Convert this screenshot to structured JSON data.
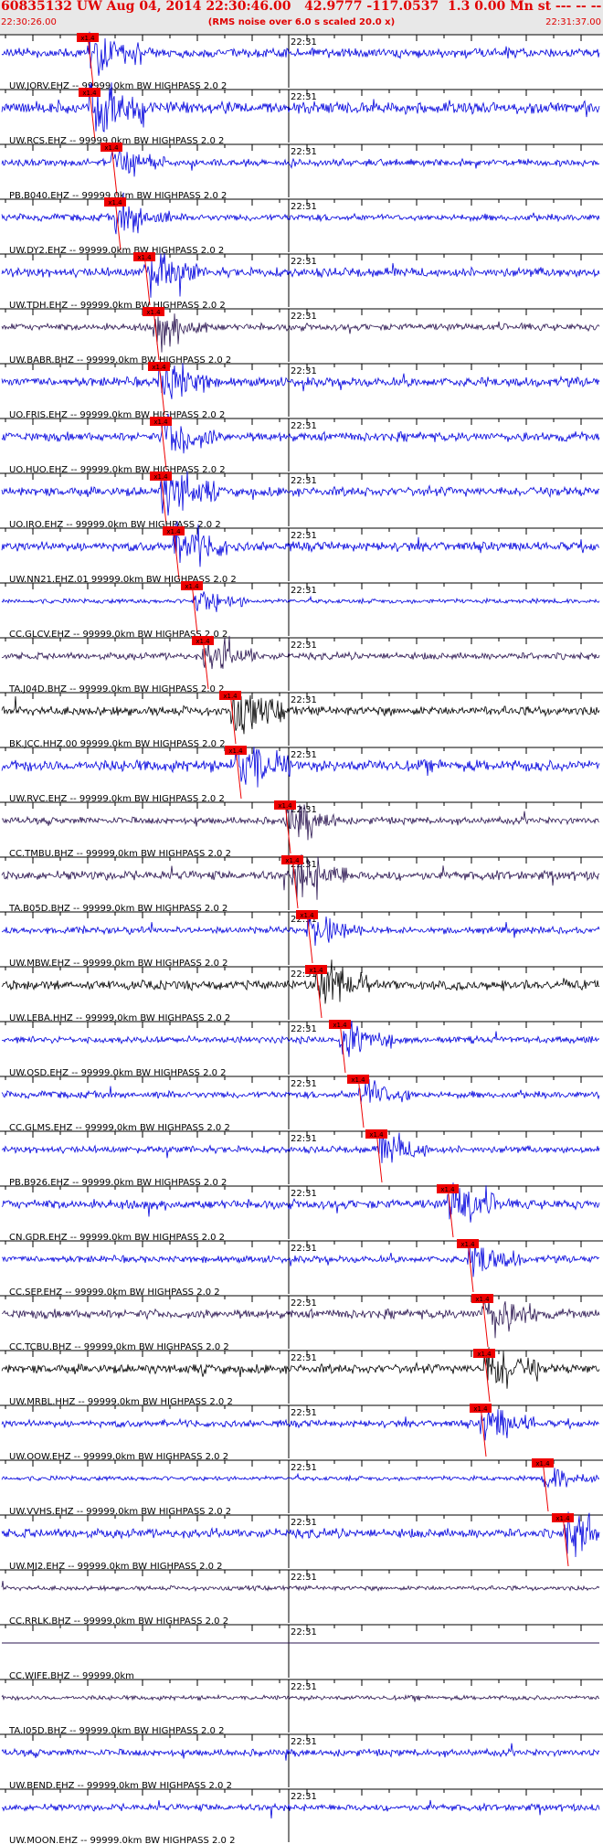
{
  "header": {
    "title": "60835132 UW Aug 04, 2014 22:30:46.00   42.9777 -117.0537  1.3 0.00 Mn st --- -- --  -1",
    "start_time": "22:30:26.00",
    "subtitle": "(RMS noise over 6.0 s scaled 20.0 x)",
    "end_time": "22:31:37.00"
  },
  "chart_data": {
    "type": "line",
    "x_range": [
      "22:30:26.00",
      "22:31:37.00"
    ],
    "minute_tick_label": "22:31",
    "pick_label": "x1.4",
    "colors": {
      "blue": "#0000dd",
      "dark": "#2a1450",
      "black": "#000000",
      "pick": "#ee0000",
      "text": "#000000"
    },
    "traces": [
      {
        "label": "UW.JORV.EHZ -- 99999.0km BW  HIGHPASS  2.0  2",
        "color": "blue",
        "amp": 4,
        "pick": true
      },
      {
        "label": "UW.RCS.EHZ -- 99999.0km BW  HIGHPASS  2.0  2",
        "color": "blue",
        "amp": 5,
        "pick": true
      },
      {
        "label": "PB.B040.EHZ -- 99999.0km BW  HIGHPASS  2.0  2",
        "color": "blue",
        "amp": 3,
        "pick": true
      },
      {
        "label": "UW.DY2.EHZ -- 99999.0km BW  HIGHPASS  2.0  2",
        "color": "blue",
        "amp": 3,
        "pick": true
      },
      {
        "label": "UW.TDH.EHZ -- 99999.0km BW  HIGHPASS  2.0  2",
        "color": "blue",
        "amp": 4,
        "pick": true
      },
      {
        "label": "UW.BABR.BHZ -- 99999.0km BW  HIGHPASS  2.0  2",
        "color": "dark",
        "amp": 3,
        "pick": true
      },
      {
        "label": "UO.FRIS.EHZ -- 99999.0km BW  HIGHPASS  2.0  2",
        "color": "blue",
        "amp": 4,
        "pick": true
      },
      {
        "label": "UO.HUO.EHZ -- 99999.0km BW  HIGHPASS  2.0  2",
        "color": "blue",
        "amp": 4,
        "pick": true
      },
      {
        "label": "UO.IRO.EHZ -- 99999.0km BW  HIGHPASS  2.0  2",
        "color": "blue",
        "amp": 4,
        "pick": true
      },
      {
        "label": "UW.NN21.EHZ.01 99999.0km BW  HIGHPASS  2.0  2",
        "color": "blue",
        "amp": 4,
        "pick": true
      },
      {
        "label": "CC.GLCV.EHZ -- 99999.0km BW  HIGHPASS  2.0  2",
        "color": "blue",
        "amp": 2,
        "pick": true
      },
      {
        "label": "TA.J04D.BHZ -- 99999.0km BW  HIGHPASS  2.0  2",
        "color": "dark",
        "amp": 3,
        "pick": true
      },
      {
        "label": "BK.JCC.HHZ.00 99999.0km BW  HIGHPASS  2.0  2",
        "color": "black",
        "amp": 4,
        "pick": true
      },
      {
        "label": "UW.RVC.EHZ -- 99999.0km BW  HIGHPASS  2.0  2",
        "color": "blue",
        "amp": 5,
        "pick": true
      },
      {
        "label": "CC.TMBU.BHZ -- 99999.0km BW  HIGHPASS  2.0  2",
        "color": "dark",
        "amp": 3,
        "pick": true
      },
      {
        "label": "TA.B05D.BHZ -- 99999.0km BW  HIGHPASS  2.0  2",
        "color": "dark",
        "amp": 4,
        "pick": true
      },
      {
        "label": "UW.MBW.EHZ -- 99999.0km BW  HIGHPASS  2.0  2",
        "color": "blue",
        "amp": 3,
        "pick": true
      },
      {
        "label": "UW.LEBA.HHZ -- 99999.0km BW  HIGHPASS  2.0  2",
        "color": "black",
        "amp": 4,
        "pick": true
      },
      {
        "label": "UW.OSD.EHZ -- 99999.0km BW  HIGHPASS  2.0  2",
        "color": "blue",
        "amp": 3,
        "pick": true
      },
      {
        "label": "CC.GLMS.EHZ -- 99999.0km BW  HIGHPASS  2.0  2",
        "color": "blue",
        "amp": 3,
        "pick": true
      },
      {
        "label": "PB.B926.EHZ -- 99999.0km BW  HIGHPASS  2.0  2",
        "color": "blue",
        "amp": 3,
        "pick": true
      },
      {
        "label": "CN.GDR.EHZ -- 99999.0km BW  HIGHPASS  2.0  2",
        "color": "blue",
        "amp": 4,
        "pick": true
      },
      {
        "label": "CC.SEP.EHZ -- 99999.0km BW  HIGHPASS  2.0  2",
        "color": "blue",
        "amp": 3,
        "pick": true
      },
      {
        "label": "CC.TCBU.BHZ -- 99999.0km BW  HIGHPASS  2.0  2",
        "color": "dark",
        "amp": 4,
        "pick": true
      },
      {
        "label": "UW.MRBL.HHZ -- 99999.0km BW  HIGHPASS  2.0  2",
        "color": "black",
        "amp": 4,
        "pick": true
      },
      {
        "label": "UW.OOW.EHZ -- 99999.0km BW  HIGHPASS  2.0  2",
        "color": "blue",
        "amp": 3,
        "pick": true
      },
      {
        "label": "UW.VVHS.EHZ -- 99999.0km BW  HIGHPASS  2.0  2",
        "color": "blue",
        "amp": 2,
        "pick": true
      },
      {
        "label": "UW.MJ2.EHZ -- 99999.0km BW  HIGHPASS  2.0  2",
        "color": "blue",
        "amp": 4,
        "pick": true
      },
      {
        "label": "CC.RRLK.BHZ -- 99999.0km BW  HIGHPASS  2.0  2",
        "color": "dark",
        "amp": 2,
        "pick": false
      },
      {
        "label": "CC.WIFE.BHZ -- 99999.0km",
        "color": "dark",
        "amp": 0,
        "pick": false
      },
      {
        "label": "TA.I05D.BHZ -- 99999.0km BW  HIGHPASS  2.0  2",
        "color": "dark",
        "amp": 2,
        "pick": false
      },
      {
        "label": "UW.BEND.EHZ -- 99999.0km BW  HIGHPASS  2.0  2",
        "color": "blue",
        "amp": 3,
        "pick": false
      },
      {
        "label": "UW.MOON.EHZ -- 99999.0km BW  HIGHPASS  2.0  2",
        "color": "blue",
        "amp": 3,
        "pick": false
      }
    ]
  }
}
